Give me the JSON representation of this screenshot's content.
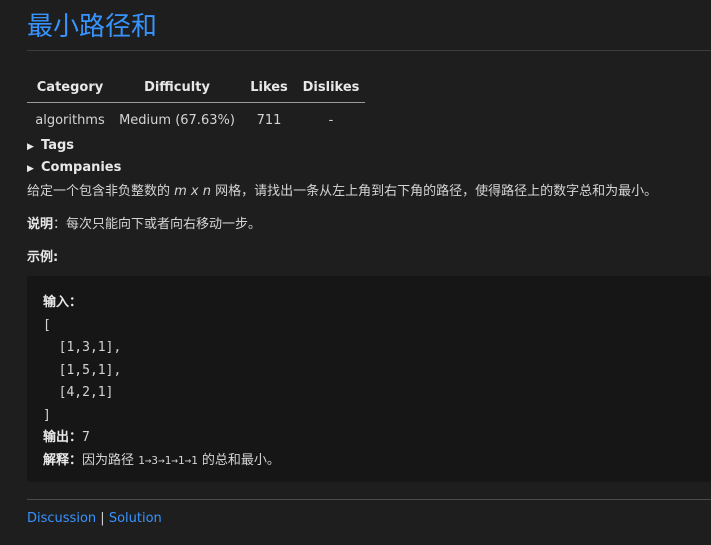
{
  "problem": {
    "title": "最小路径和"
  },
  "meta_table": {
    "headers": [
      "Category",
      "Difficulty",
      "Likes",
      "Dislikes"
    ],
    "row": [
      "algorithms",
      "Medium (67.63%)",
      "711",
      "-"
    ]
  },
  "details": {
    "tags_label": "Tags",
    "companies_label": "Companies",
    "triangle": "▶"
  },
  "description": {
    "before": "给定一个包含非负整数的 ",
    "grid_expr": "m x n",
    "after": " 网格，请找出一条从左上角到右下角的路径，使得路径上的数字总和为最小。",
    "note_label": "说明",
    "note_text": "：每次只能向下或者向右移动一步。",
    "example_label": "示例:"
  },
  "example": {
    "input_label": "输入：",
    "input_lines": [
      "[",
      "  [1,3,1],",
      "  [1,5,1],",
      "  [4,2,1]",
      "]"
    ],
    "output_label": "输出：",
    "output_value": "7",
    "explain_label": "解释：",
    "explain_prefix": "因为路径 ",
    "explain_path": "1→3→1→1→1",
    "explain_suffix": " 的总和最小。"
  },
  "footer": {
    "discussion": "Discussion",
    "separator": "|",
    "solution": "Solution"
  }
}
